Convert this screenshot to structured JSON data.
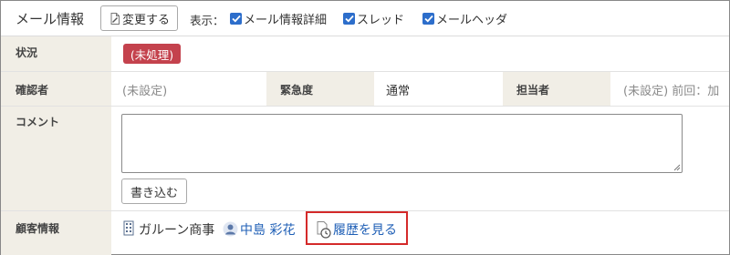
{
  "header": {
    "title": "メール情報",
    "change_button": "変更する",
    "display_label": "表示：",
    "checkboxes": [
      {
        "label": "メール情報詳細",
        "checked": true
      },
      {
        "label": "スレッド",
        "checked": true
      },
      {
        "label": "メールヘッダ",
        "checked": true
      }
    ]
  },
  "status": {
    "label": "状況",
    "badge": "(未処理)",
    "badge_color": "#c4424d"
  },
  "confirm": {
    "label": "確認者",
    "value": "(未設定)",
    "urgency_label": "緊急度",
    "urgency_value": "通常",
    "assignee_label": "担当者",
    "assignee_value": "(未設定)  前回：加"
  },
  "comment": {
    "label": "コメント",
    "value": "",
    "write_button": "書き込む"
  },
  "customer": {
    "label": "顧客情報",
    "company": "ガルーン商事",
    "person": "中島 彩花",
    "history_link": "履歴を見る",
    "link_color": "#1f5fb6",
    "highlight_color": "#d42a2a"
  }
}
